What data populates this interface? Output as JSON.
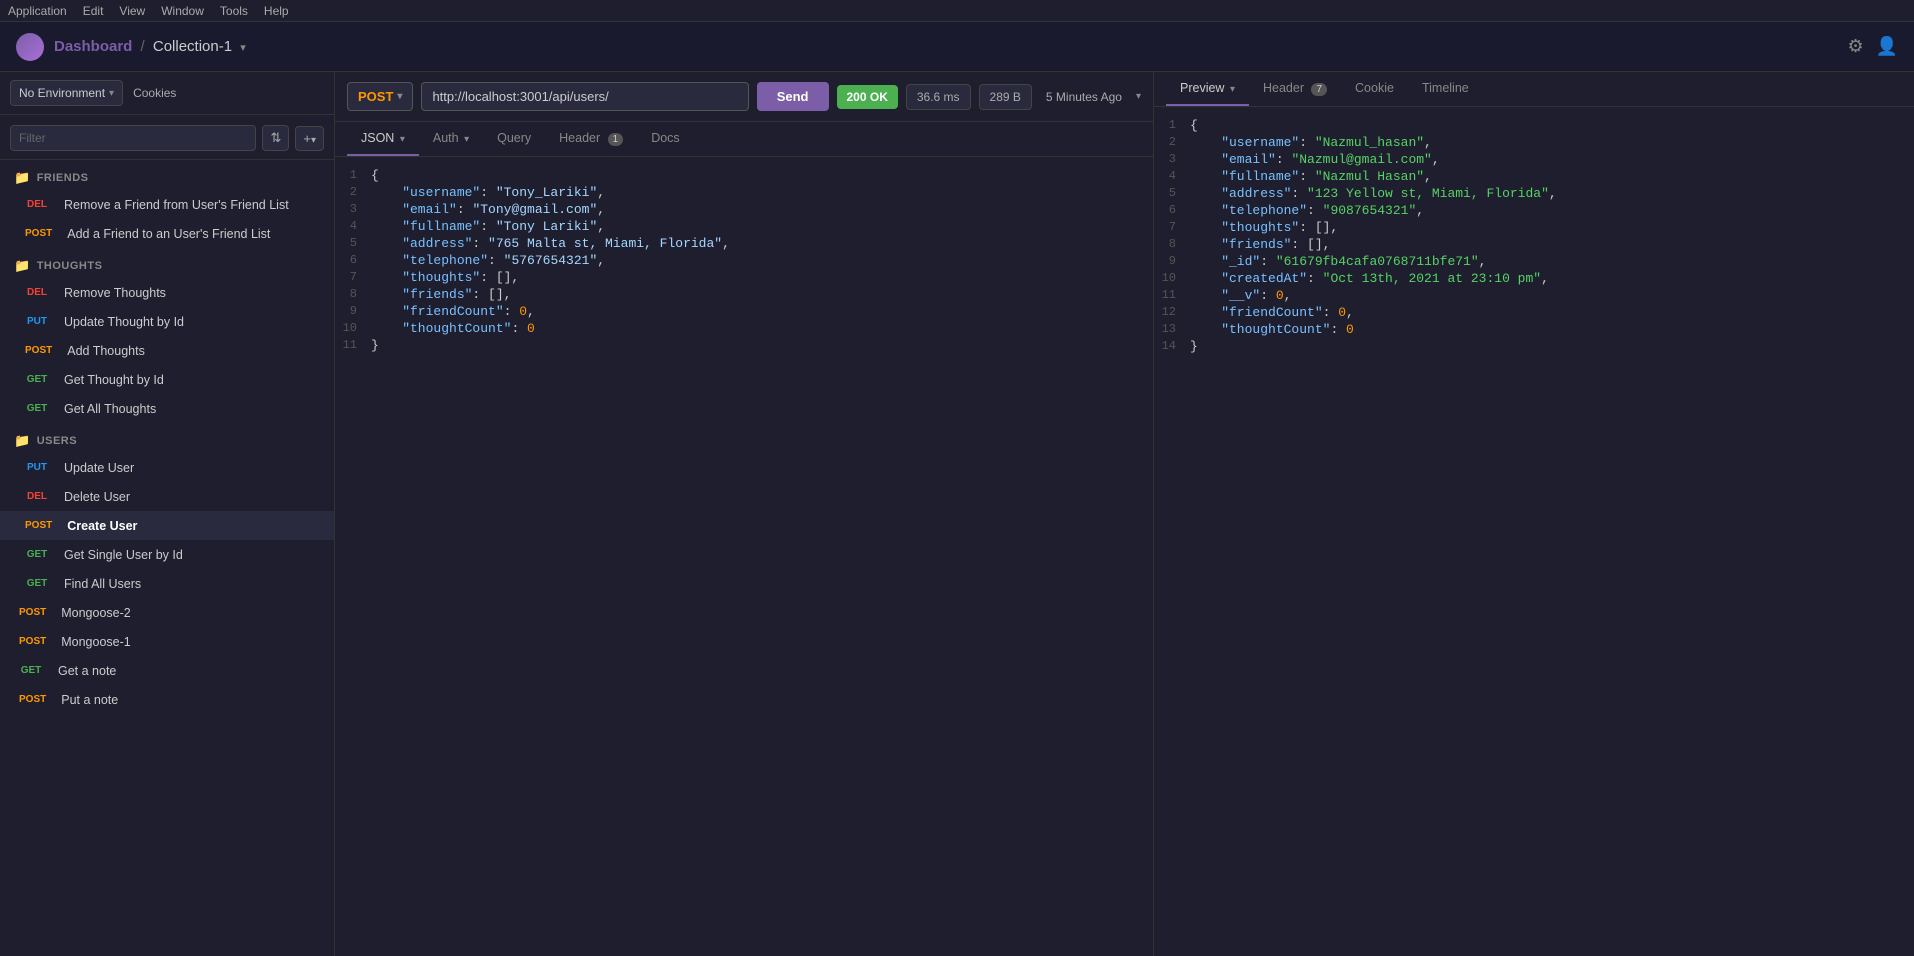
{
  "menuBar": {
    "items": [
      "Application",
      "Edit",
      "View",
      "Window",
      "Tools",
      "Help"
    ]
  },
  "titleBar": {
    "breadcrumb": {
      "active": "Dashboard",
      "separator": "/",
      "collection": "Collection-1"
    },
    "icons": {
      "settings": "⚙",
      "user": "👤"
    }
  },
  "env": {
    "label": "No Environment",
    "cookies": "Cookies"
  },
  "sidebar": {
    "filterPlaceholder": "Filter",
    "sections": {
      "friends": {
        "label": "FRIENDS",
        "items": [
          {
            "method": "DEL",
            "label": "Remove a Friend from User's Friend List",
            "methodClass": "del"
          },
          {
            "method": "POST",
            "label": "Add a Friend to an User's Friend List",
            "methodClass": "post"
          }
        ]
      },
      "thoughts": {
        "label": "THOUGHTS",
        "items": [
          {
            "method": "DEL",
            "label": "Remove Thoughts",
            "methodClass": "del"
          },
          {
            "method": "PUT",
            "label": "Update Thought by Id",
            "methodClass": "put"
          },
          {
            "method": "POST",
            "label": "Add Thoughts",
            "methodClass": "post"
          },
          {
            "method": "GET",
            "label": "Get Thought by Id",
            "methodClass": "get"
          },
          {
            "method": "GET",
            "label": "Get All Thoughts",
            "methodClass": "get"
          }
        ]
      },
      "users": {
        "label": "USERS",
        "items": [
          {
            "method": "PUT",
            "label": "Update User",
            "methodClass": "put"
          },
          {
            "method": "DEL",
            "label": "Delete User",
            "methodClass": "del"
          },
          {
            "method": "POST",
            "label": "Create User",
            "methodClass": "post",
            "active": true
          },
          {
            "method": "GET",
            "label": "Get Single User by Id",
            "methodClass": "get"
          },
          {
            "method": "GET",
            "label": "Find All Users",
            "methodClass": "get"
          }
        ]
      }
    },
    "topItems": [
      {
        "method": "POST",
        "label": "Mongoose-2",
        "methodClass": "post"
      },
      {
        "method": "POST",
        "label": "Mongoose-1",
        "methodClass": "post"
      },
      {
        "method": "GET",
        "label": "Get a note",
        "methodClass": "get"
      },
      {
        "method": "POST",
        "label": "Put a note",
        "methodClass": "post"
      }
    ]
  },
  "requestBar": {
    "method": "POST",
    "url": "http://localhost:3001/api/users/",
    "sendLabel": "Send",
    "status": "200 OK",
    "time": "36.6 ms",
    "size": "289 B",
    "timestamp": "5 Minutes Ago"
  },
  "requestTabs": {
    "active": "JSON",
    "items": [
      {
        "label": "JSON",
        "active": true,
        "arrow": true
      },
      {
        "label": "Auth",
        "arrow": true
      },
      {
        "label": "Query"
      },
      {
        "label": "Header",
        "badge": "1"
      },
      {
        "label": "Docs"
      }
    ]
  },
  "requestBody": {
    "lines": [
      {
        "num": 1,
        "content": "{"
      },
      {
        "num": 2,
        "key": "\"username\"",
        "val": "\"Tony_Lariki\"",
        "comma": true
      },
      {
        "num": 3,
        "key": "\"email\"",
        "val": "\"Tony@gmail.com\"",
        "comma": true
      },
      {
        "num": 4,
        "key": "\"fullname\"",
        "val": "\"Tony Lariki\"",
        "comma": true
      },
      {
        "num": 5,
        "key": "\"address\"",
        "val": "\"765 Malta st, Miami, Florida\"",
        "comma": true
      },
      {
        "num": 6,
        "key": "\"telephone\"",
        "val": "\"5767654321\"",
        "comma": true
      },
      {
        "num": 7,
        "key": "\"thoughts\"",
        "val": "[]",
        "comma": true,
        "isArr": true
      },
      {
        "num": 8,
        "key": "\"friends\"",
        "val": "[]",
        "comma": true,
        "isArr": true
      },
      {
        "num": 9,
        "key": "\"friendCount\"",
        "val": "0",
        "comma": true,
        "isNum": true
      },
      {
        "num": 10,
        "key": "\"thoughtCount\"",
        "val": "0",
        "isNum": true
      },
      {
        "num": 11,
        "content": "}"
      }
    ]
  },
  "responseTabs": {
    "active": "Preview",
    "items": [
      {
        "label": "Preview",
        "active": true,
        "arrow": true
      },
      {
        "label": "Header",
        "badge": "7"
      },
      {
        "label": "Cookie"
      },
      {
        "label": "Timeline"
      }
    ]
  },
  "responseBody": {
    "lines": [
      {
        "num": 1,
        "content": "{"
      },
      {
        "num": 2,
        "key": "\"username\"",
        "val": "\"Nazmul_hasan\"",
        "comma": true
      },
      {
        "num": 3,
        "key": "\"email\"",
        "val": "\"Nazmul@gmail.com\"",
        "comma": true
      },
      {
        "num": 4,
        "key": "\"fullname\"",
        "val": "\"Nazmul Hasan\"",
        "comma": true
      },
      {
        "num": 5,
        "key": "\"address\"",
        "val": "\"123 Yellow st, Miami, Florida\"",
        "comma": true
      },
      {
        "num": 6,
        "key": "\"telephone\"",
        "val": "\"9087654321\"",
        "comma": true
      },
      {
        "num": 7,
        "key": "\"thoughts\"",
        "val": "[]",
        "comma": true,
        "isArr": true
      },
      {
        "num": 8,
        "key": "\"friends\"",
        "val": "[]",
        "comma": true,
        "isArr": true
      },
      {
        "num": 9,
        "key": "\"_id\"",
        "val": "\"61679fb4cafa0768711bfe71\"",
        "comma": true
      },
      {
        "num": 10,
        "key": "\"createdAt\"",
        "val": "\"Oct 13th, 2021 at 23:10 pm\"",
        "comma": true
      },
      {
        "num": 11,
        "key": "\"__v\"",
        "val": "0",
        "comma": true,
        "isNum": true
      },
      {
        "num": 12,
        "key": "\"friendCount\"",
        "val": "0",
        "comma": true,
        "isNum": true
      },
      {
        "num": 13,
        "key": "\"thoughtCount\"",
        "val": "0",
        "isNum": true
      },
      {
        "num": 14,
        "content": "}"
      }
    ]
  }
}
